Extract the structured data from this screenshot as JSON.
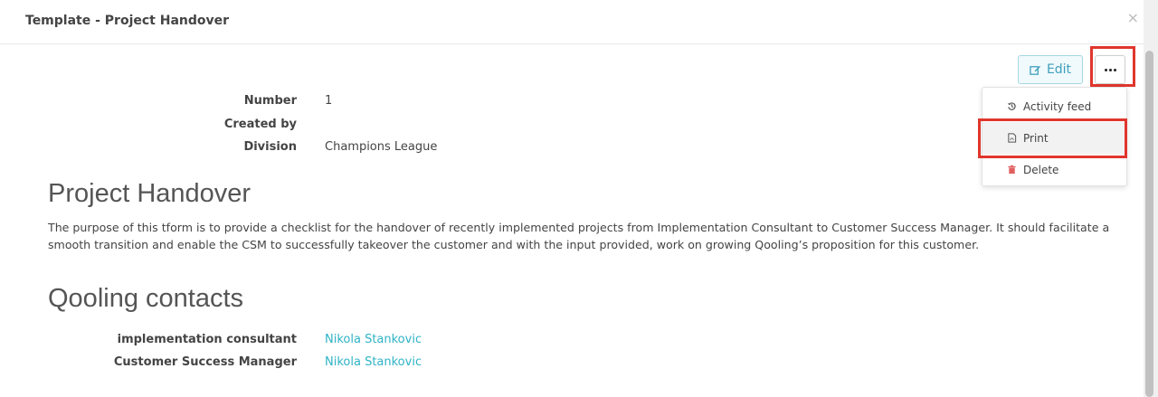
{
  "modal": {
    "title": "Template - Project Handover",
    "close_icon": "×"
  },
  "toolbar": {
    "edit_label": "Edit",
    "more_icon": "ellipsis-icon"
  },
  "dropdown": {
    "items": [
      {
        "label": "Activity feed",
        "icon": "history-icon"
      },
      {
        "label": "Print",
        "icon": "pdf-file-icon"
      },
      {
        "label": "Delete",
        "icon": "trash-icon"
      }
    ]
  },
  "details": {
    "number_label": "Number",
    "number_value": "1",
    "created_by_label": "Created by",
    "created_by_value": "",
    "division_label": "Division",
    "division_value": "Champions League"
  },
  "project": {
    "title": "Project Handover",
    "description": "The purpose of this tform is to provide a checklist for the handover of recently implemented projects from Implementation Consultant to Customer Success Manager. It should facilitate a smooth transition and enable the CSM to successfully takeover the customer and with the input provided, work on growing Qooling’s proposition for this customer."
  },
  "contacts": {
    "title": "Qooling contacts",
    "implementation_label": "implementation consultant",
    "implementation_value": "Nikola Stankovic",
    "csm_label": "Customer Success Manager",
    "csm_value": "Nikola Stankovic"
  },
  "colors": {
    "accent": "#2fb3c6",
    "highlight": "#e0362c",
    "delete": "#d9534f"
  }
}
